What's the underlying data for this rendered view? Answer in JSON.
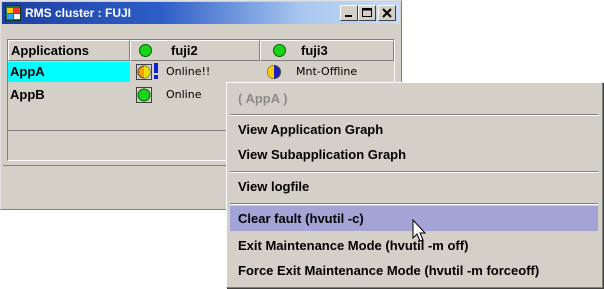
{
  "window": {
    "title": "RMS cluster : FUJI",
    "icon": "rms-cluster-icon",
    "controls": [
      "minimize-icon",
      "maximize-icon",
      "close-icon"
    ]
  },
  "table": {
    "headers": [
      "Applications",
      "fuji2",
      "fuji3"
    ],
    "header_status": [
      "online",
      "online"
    ],
    "rows": [
      {
        "name": "AppA",
        "selected": true,
        "fuji2": {
          "text": "Online!!",
          "icon": "online-fault-icon"
        },
        "fuji3": {
          "text": "Mnt-Offline",
          "icon": "maintenance-offline-icon"
        }
      },
      {
        "name": "AppB",
        "selected": false,
        "fuji2": {
          "text": "Online",
          "icon": "online-icon"
        },
        "fuji3": {
          "text": "",
          "icon": ""
        }
      }
    ]
  },
  "context_menu": {
    "header": "( AppA )",
    "items": [
      "View Application Graph",
      "View Subapplication Graph",
      "View logfile",
      "Clear fault (hvutil -c)",
      "Exit Maintenance Mode (hvutil -m off)",
      "Force Exit Maintenance Mode (hvutil -m forceoff)"
    ],
    "highlighted_index": 3
  },
  "colors": {
    "selection": "#00ffff",
    "online": "#18d418",
    "menu_highlight": "#a3a3d6",
    "titlebar": "#1d3fa3"
  }
}
